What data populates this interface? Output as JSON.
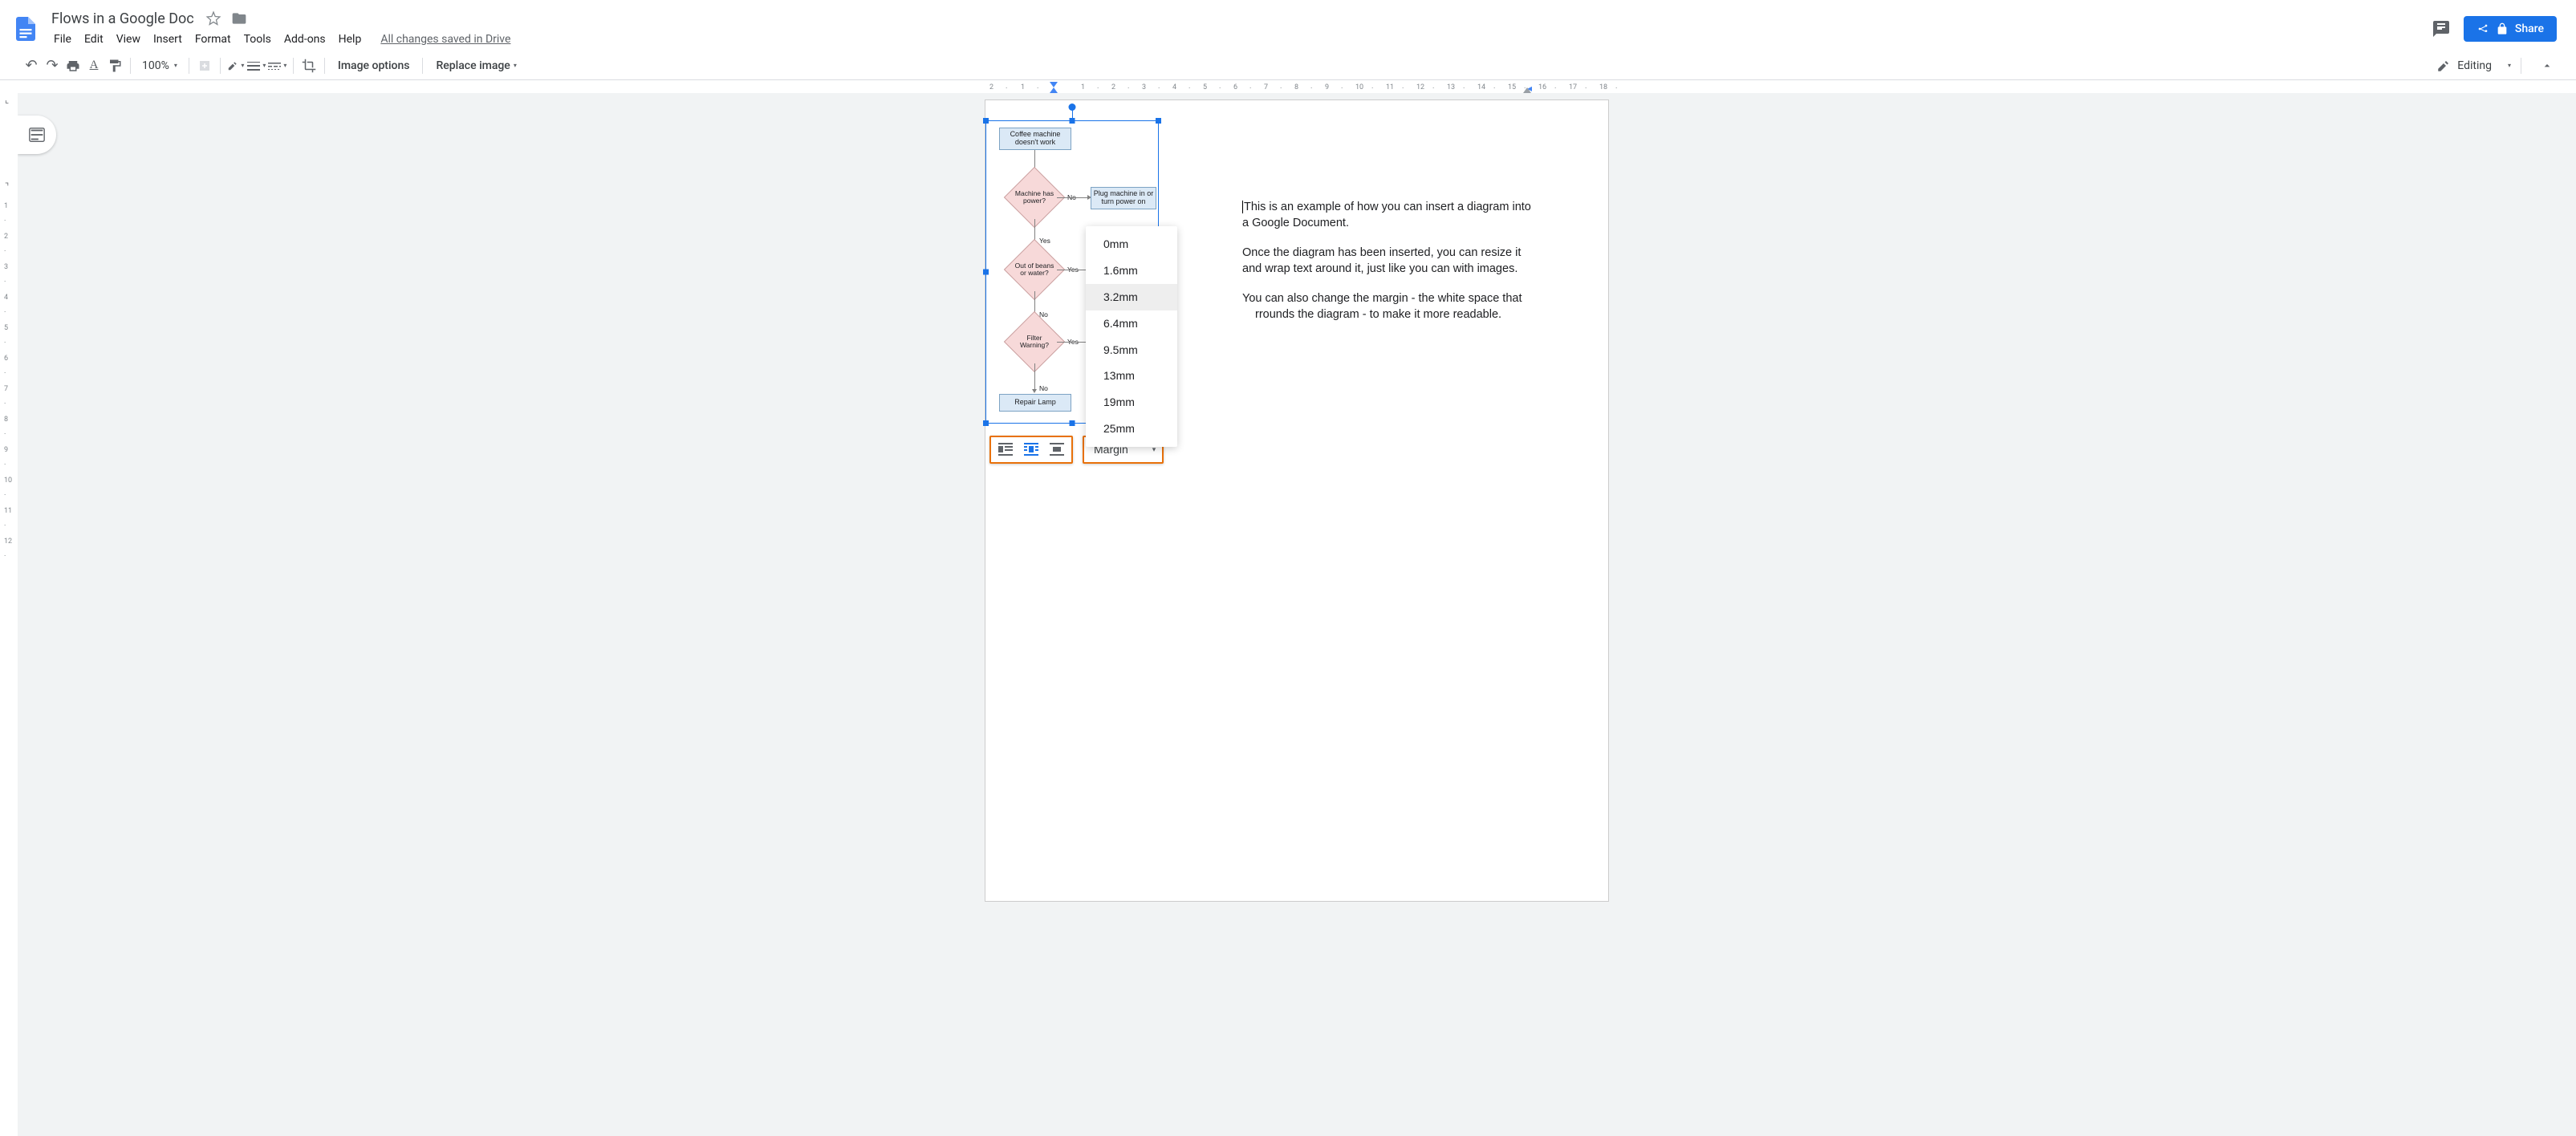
{
  "title": "Flows in a Google Doc",
  "menus": {
    "file": "File",
    "edit": "Edit",
    "view": "View",
    "insert": "Insert",
    "format": "Format",
    "tools": "Tools",
    "addons": "Add-ons",
    "help": "Help"
  },
  "save_status": "All changes saved in Drive",
  "share_label": "Share",
  "toolbar": {
    "zoom": "100%",
    "image_options": "Image options",
    "replace_image": "Replace image",
    "editing": "Editing"
  },
  "hruler_marks": [
    "2",
    "1",
    "1",
    "2",
    "3",
    "4",
    "5",
    "6",
    "7",
    "8",
    "9",
    "10",
    "11",
    "12",
    "13",
    "14",
    "15",
    "16",
    "17",
    "18"
  ],
  "vruler_marks": [
    "1",
    "2",
    "3",
    "4",
    "5",
    "6",
    "7",
    "8",
    "9",
    "10",
    "11",
    "12"
  ],
  "flowchart": {
    "start": "Coffee machine doesn't work",
    "q_power": "Machine has power?",
    "a_no1": "No",
    "plug": "Plug machine in or turn power on",
    "a_yes1": "Yes",
    "q_beans": "Out of beans or water?",
    "a_yes2": "Yes",
    "a_no2": "No",
    "q_filter": "Filter Warning?",
    "a_yes3": "Yes",
    "a_no3": "No",
    "repair": "Repair Lamp"
  },
  "margin_menu": {
    "items": [
      "0mm",
      "1.6mm",
      "3.2mm",
      "6.4mm",
      "9.5mm",
      "13mm",
      "19mm",
      "25mm"
    ],
    "selected": "3.2mm",
    "button_label": "Margin"
  },
  "paragraphs": {
    "p1a": "This is an example of how you can insert a diagram into",
    "p1b": "a Google Document.",
    "p2a": "Once the diagram has been inserted, you can resize it",
    "p2b": "and wrap text around it, just like you can with images.",
    "p3a": "You can also change the margin - the white space that",
    "p3b": "rrounds the diagram - to make it more readable."
  }
}
